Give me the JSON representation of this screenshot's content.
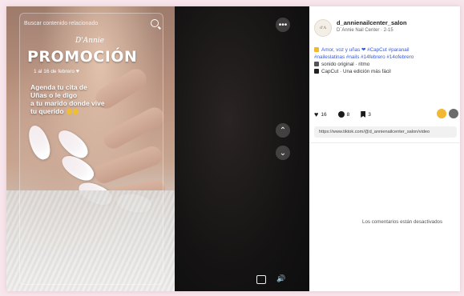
{
  "video": {
    "search_placeholder": "Buscar contenido relacionado",
    "brand_script": "D'Annie",
    "promo_title": "PROMOCIÓN",
    "promo_sub": "1 al 16 de febrero",
    "promo_lines": [
      "Agenda tu cita de",
      "Uñas o le digo",
      "a tu marido donde vive",
      "tu querido"
    ],
    "icons": {
      "search": "search-icon",
      "more": "more-icon",
      "up": "chevron-up-icon",
      "down": "chevron-down-icon",
      "caption": "caption-icon",
      "volume": "volume-icon"
    }
  },
  "post": {
    "avatar_text": "d'A",
    "username": "d_annienailcenter_salon",
    "subtitle": "D´Annie Nail Center · 2-15",
    "caption_line1": "Amor, voz y uñas ❤ #CapCut #paranail",
    "caption_line2": "#naileslatinas #nails #14febrero #14ofebrero",
    "caption_line3": "sonido original · ritmo",
    "caption_line4": "CapCut · Una edición más fácil",
    "likes": "16",
    "comments": "8",
    "saves": "3",
    "link": "https://www.tiktok.com/@d_annienailcenter_salon/video",
    "empty_message": "Los comentarios están desactivados"
  },
  "colors": {
    "accent_blue": "#3a5ad9",
    "emoji_yellow": "#f2b733",
    "page_bg": "#f7e6ec"
  }
}
